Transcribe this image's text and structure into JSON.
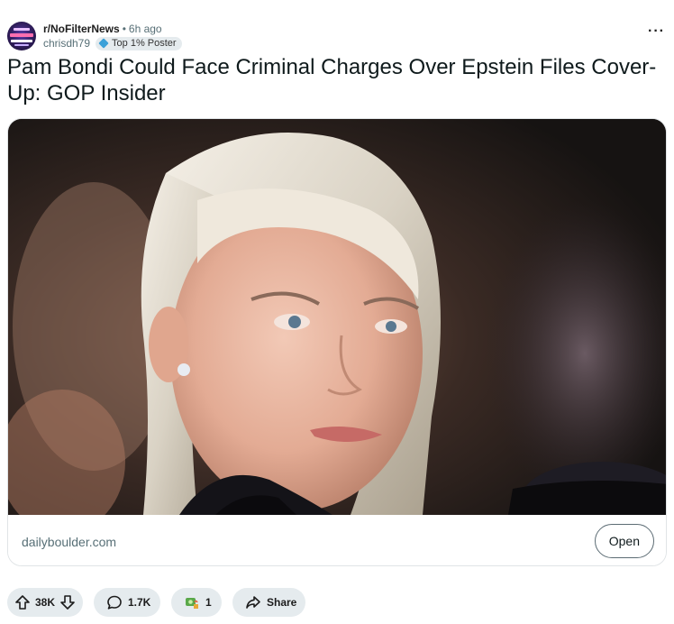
{
  "post": {
    "subreddit": "r/NoFilterNews",
    "time": "6h ago",
    "separator": "•",
    "username": "chrisdh79",
    "flair": "Top 1% Poster",
    "more_label": "···",
    "title": "Pam Bondi Could Face Criminal Charges Over Epstein Files Cover-Up: GOP Insider",
    "link_domain": "dailyboulder.com",
    "open_label": "Open"
  },
  "actions": {
    "upvotes": "38K",
    "comments": "1.7K",
    "awards": "1",
    "share_label": "Share"
  },
  "icons": {
    "avatar": "subreddit-avatar",
    "flair": "diamond-icon",
    "upvote": "arrow-up-icon",
    "downvote": "arrow-down-icon",
    "comment": "speech-bubble-icon",
    "award": "award-icon",
    "share": "share-arrow-icon"
  },
  "colors": {
    "text": "#1c1c1c",
    "muted": "#576f76",
    "pill_bg": "#e5ebee",
    "flair_icon": "#3aa0d8"
  }
}
